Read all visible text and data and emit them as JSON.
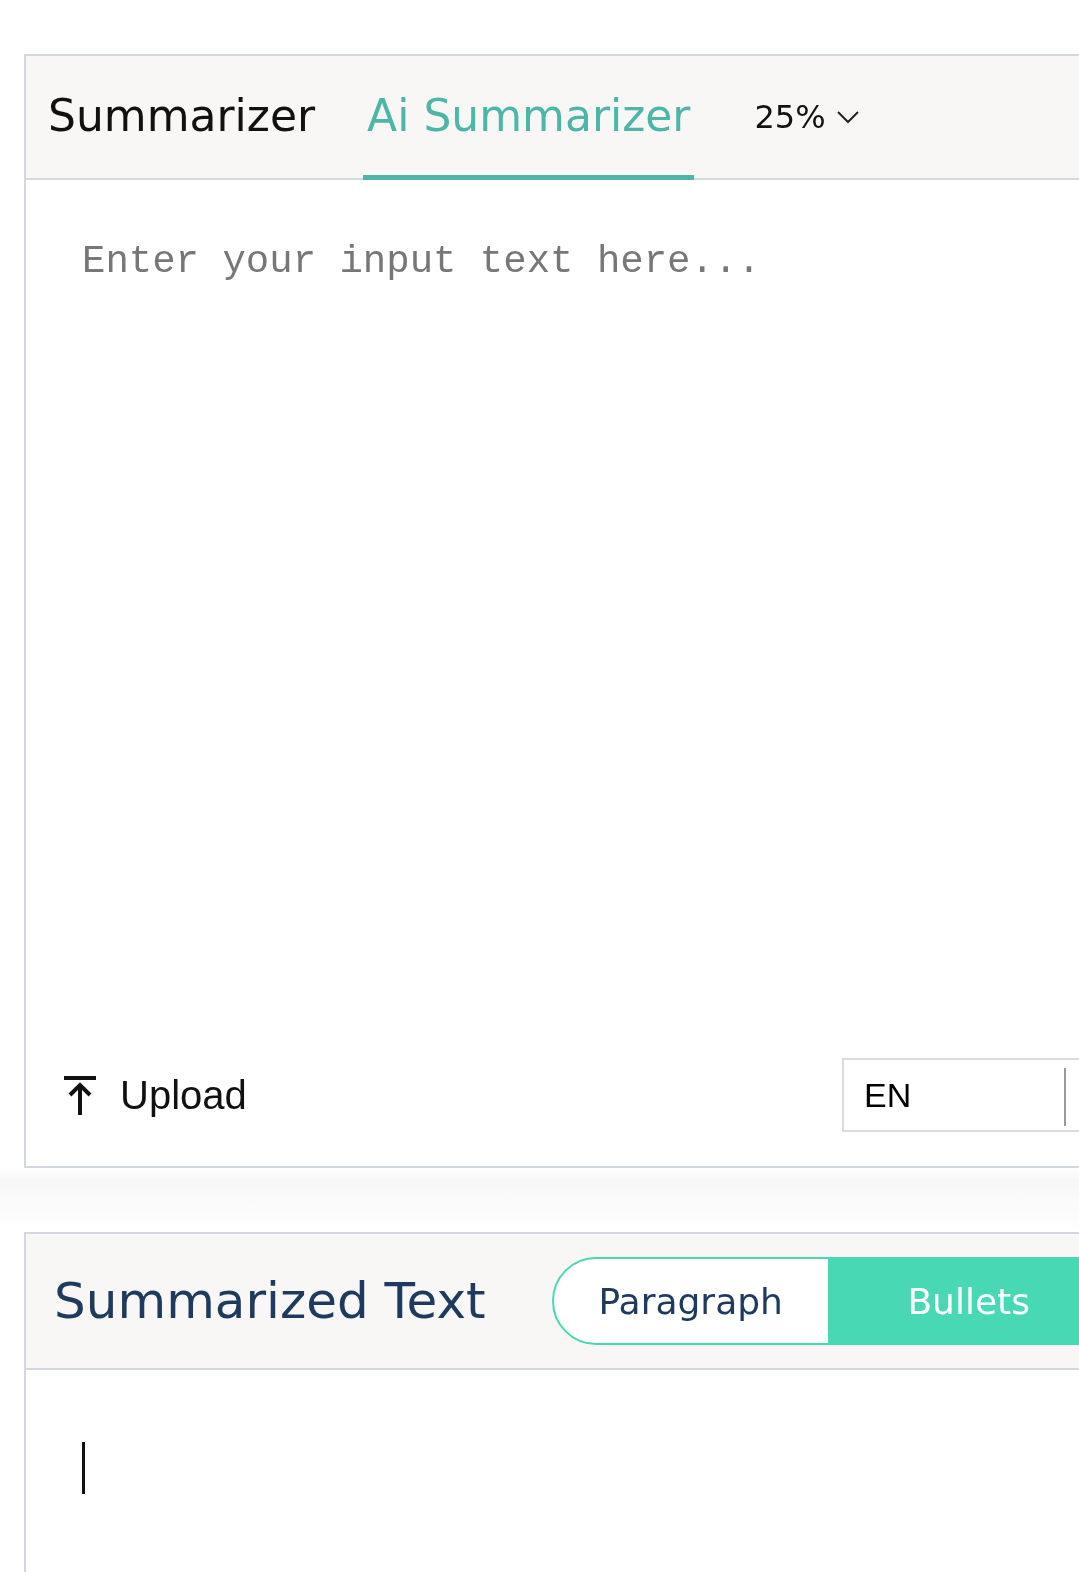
{
  "tabs": [
    {
      "label": "Summarizer",
      "selected": false
    },
    {
      "label": "Ai Summarizer",
      "selected": true
    }
  ],
  "ratio_dropdown": {
    "value": "25%"
  },
  "input": {
    "placeholder": "Enter your input text here..."
  },
  "upload_button": {
    "label": "Upload"
  },
  "language_select": {
    "value": "EN"
  },
  "output": {
    "title": "Summarized Text",
    "modes": [
      {
        "label": "Paragraph",
        "selected": false
      },
      {
        "label": "Bullets",
        "selected": true
      }
    ]
  }
}
